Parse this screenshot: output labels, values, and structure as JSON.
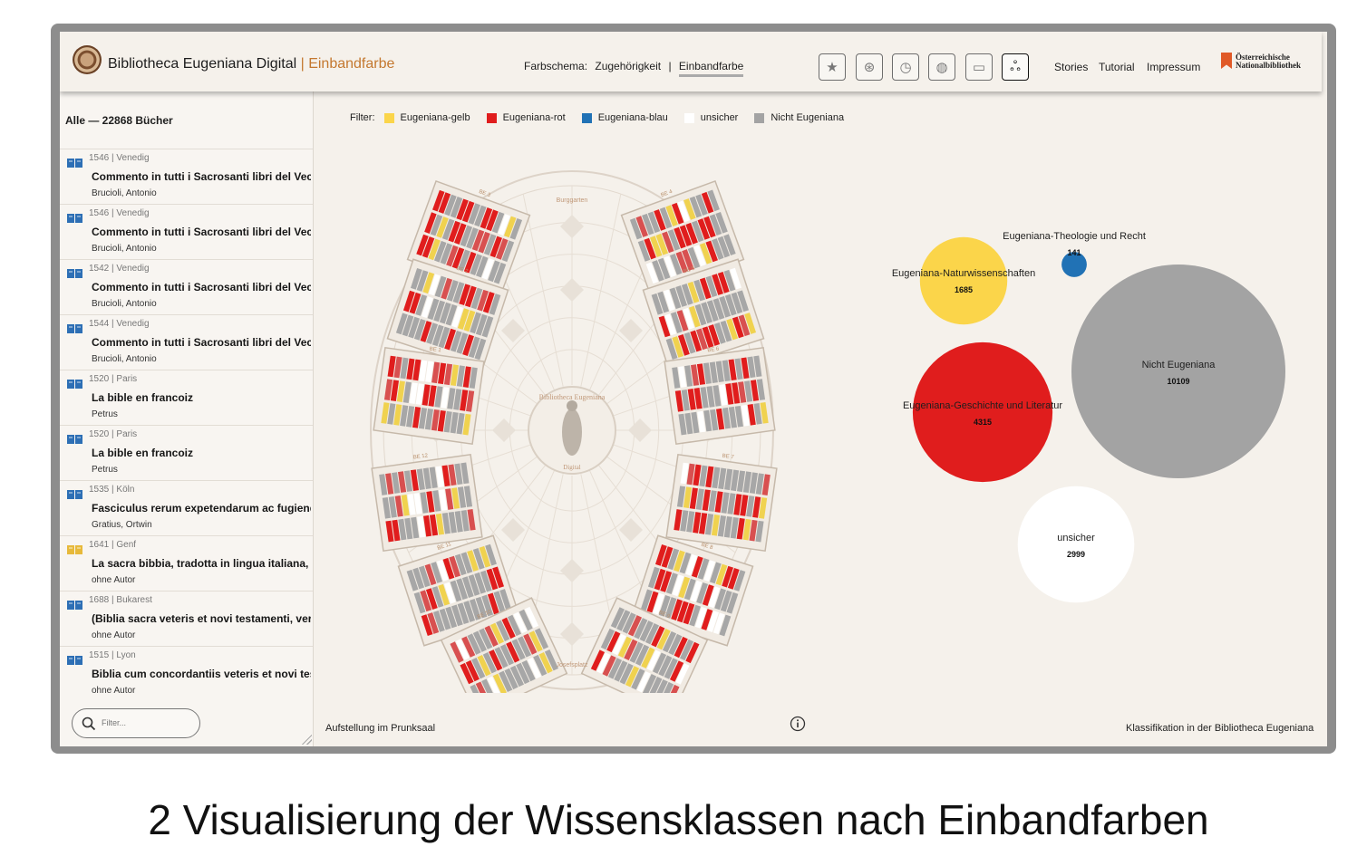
{
  "app": {
    "name": "Bibliotheca Eugeniana Digital",
    "subtitle": "| Einbandfarbe"
  },
  "header": {
    "scheme_label": "Farbschema:",
    "scheme_option_1": "Zugehörigkeit",
    "scheme_sep": "|",
    "scheme_option_2": "Einbandfarbe",
    "tools": [
      "star-icon",
      "wheel-icon",
      "clock-icon",
      "globe-icon",
      "speech-bubble-icon",
      "bubble-chart-icon"
    ],
    "tools_glyphs": [
      "★",
      "⊛",
      "◷",
      "◍",
      "▭",
      "ஃ"
    ],
    "nav": [
      "Stories",
      "Tutorial",
      "Impressum"
    ],
    "onb_line1": "Österreichische",
    "onb_line2": "Nationalbibliothek"
  },
  "sidebar": {
    "count": "Alle — 22868 Bücher",
    "books": [
      {
        "meta": "1546 | Venedig",
        "title": "Commento in tutti i Sacrosanti libri del Vecchi...",
        "author": "Brucioli, Antonio",
        "color": "#2d6fb5"
      },
      {
        "meta": "1546 | Venedig",
        "title": "Commento in tutti i Sacrosanti libri del Vecchi...",
        "author": "Brucioli, Antonio",
        "color": "#2d6fb5"
      },
      {
        "meta": "1542 | Venedig",
        "title": "Commento in tutti i Sacrosanti libri del Vecchi...",
        "author": "Brucioli, Antonio",
        "color": "#2d6fb5"
      },
      {
        "meta": "1544 | Venedig",
        "title": "Commento in tutti i Sacrosanti libri del Vecchi...",
        "author": "Brucioli, Antonio",
        "color": "#2d6fb5"
      },
      {
        "meta": "1520 | Paris",
        "title": "La bible en francoiz",
        "author": "Petrus",
        "color": "#2d6fb5"
      },
      {
        "meta": "1520 | Paris",
        "title": "La bible en francoiz",
        "author": "Petrus",
        "color": "#2d6fb5"
      },
      {
        "meta": "1535 | Köln",
        "title": "Fasciculus rerum expetendarum ac fugiendaru...",
        "author": "Gratius, Ortwin",
        "color": "#2d6fb5"
      },
      {
        "meta": "1641 | Genf",
        "title": "La sacra bibbia, tradotta in lingua italiana, e c...",
        "author": "ohne Autor",
        "color": "#e7b93a"
      },
      {
        "meta": "1688 | Bukarest",
        "title": "(Biblia sacra veteris et novi testamenti, versa ...",
        "author": "ohne Autor",
        "color": "#2d6fb5"
      },
      {
        "meta": "1515 | Lyon",
        "title": "Biblia cum concordantiis veteris et novi testa...",
        "author": "ohne Autor",
        "color": "#2d6fb5"
      }
    ],
    "filter_placeholder": "Filter..."
  },
  "legend": {
    "label": "Filter:",
    "items": [
      {
        "label": "Eugeniana-gelb",
        "color": "#fbd54a"
      },
      {
        "label": "Eugeniana-rot",
        "color": "#e01d1d"
      },
      {
        "label": "Eugeniana-blau",
        "color": "#2172b5"
      },
      {
        "label": "unsicher",
        "color": "#ffffff"
      },
      {
        "label": "Nicht Eugeniana",
        "color": "#a3a3a3"
      }
    ]
  },
  "hall": {
    "top_label": "Burggarten",
    "bottom_label": "Josefsplatz",
    "center_label_1": "Bibliotheca Eugeniana",
    "center_label_2": "Digital",
    "shelf_labels": [
      "BE 3",
      "BE 4",
      "BE 2",
      "BE 5",
      "BE 1",
      "BE 6",
      "BE 12",
      "BE 7",
      "BE 11",
      "BE 8",
      "BE 10",
      "BE 9"
    ]
  },
  "chart_data": {
    "type": "bubble",
    "title": "",
    "series": [
      {
        "label": "Eugeniana-Theologie und Recht",
        "value": 141,
        "color": "#2172b5"
      },
      {
        "label": "Eugeniana-Naturwissenschaften",
        "value": 1685,
        "color": "#fbd54a"
      },
      {
        "label": "Eugeniana-Geschichte und Literatur",
        "value": 4315,
        "color": "#e01d1d"
      },
      {
        "label": "Nicht Eugeniana",
        "value": 10109,
        "color": "#a3a3a3"
      },
      {
        "label": "unsicher",
        "value": 2999,
        "color": "#ffffff"
      }
    ]
  },
  "footer": {
    "left": "Aufstellung im Prunksaal",
    "right": "Klassifikation in der Bibliotheca Eugeniana"
  },
  "caption": "2 Visualisierung der Wissensklassen nach Einbandfarben"
}
